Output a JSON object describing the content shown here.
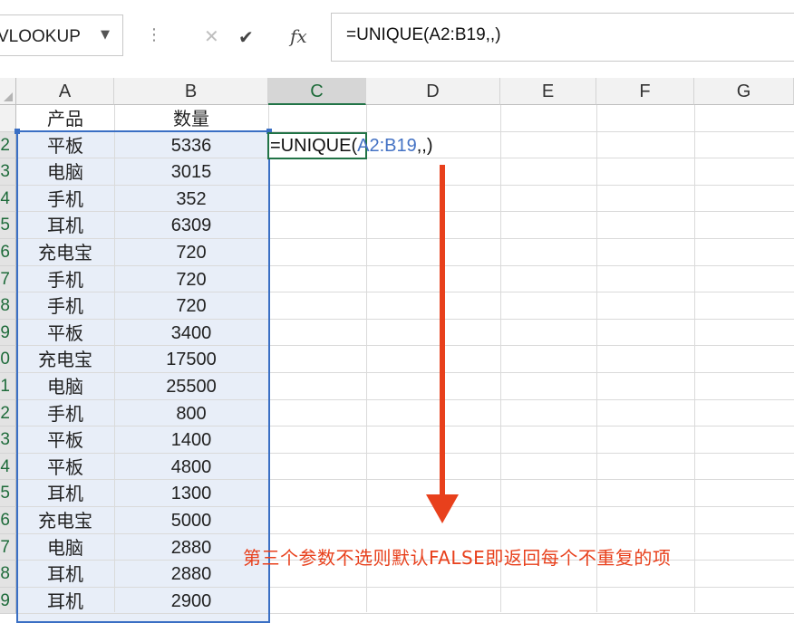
{
  "formula_bar": {
    "name_box": "VLOOKUP",
    "cancel_icon": "cross-icon",
    "enter_icon": "checkmark-icon",
    "fx_label": "fx",
    "formula": "=UNIQUE(A2:B19,,)"
  },
  "columns": [
    "A",
    "B",
    "C",
    "D",
    "E",
    "F",
    "G"
  ],
  "rows": [
    {
      "row": "",
      "a": "产品",
      "b": "数量"
    },
    {
      "row": "2",
      "a": "平板",
      "b": "5336"
    },
    {
      "row": "3",
      "a": "电脑",
      "b": "3015"
    },
    {
      "row": "4",
      "a": "手机",
      "b": "352"
    },
    {
      "row": "5",
      "a": "耳机",
      "b": "6309"
    },
    {
      "row": "6",
      "a": "充电宝",
      "b": "720"
    },
    {
      "row": "7",
      "a": "手机",
      "b": "720"
    },
    {
      "row": "8",
      "a": "手机",
      "b": "720"
    },
    {
      "row": "9",
      "a": "平板",
      "b": "3400"
    },
    {
      "row": "0",
      "a": "充电宝",
      "b": "17500"
    },
    {
      "row": "1",
      "a": "电脑",
      "b": "25500"
    },
    {
      "row": "2",
      "a": "手机",
      "b": "800"
    },
    {
      "row": "3",
      "a": "平板",
      "b": "1400"
    },
    {
      "row": "4",
      "a": "平板",
      "b": "4800"
    },
    {
      "row": "5",
      "a": "耳机",
      "b": "1300"
    },
    {
      "row": "6",
      "a": "充电宝",
      "b": "5000"
    },
    {
      "row": "7",
      "a": "电脑",
      "b": "2880"
    },
    {
      "row": "8",
      "a": "耳机",
      "b": "2880"
    },
    {
      "row": "9",
      "a": "耳机",
      "b": "2900"
    }
  ],
  "editing_cell": {
    "prefix": "=UNIQUE(",
    "ref": "A2:B19",
    "suffix": ",,)"
  },
  "annotation": "第三个参数不选则默认FALSE即返回每个不重复的项",
  "colors": {
    "selection": "#3a6fc4",
    "active_cell": "#217346",
    "annotation": "#e8401c"
  }
}
